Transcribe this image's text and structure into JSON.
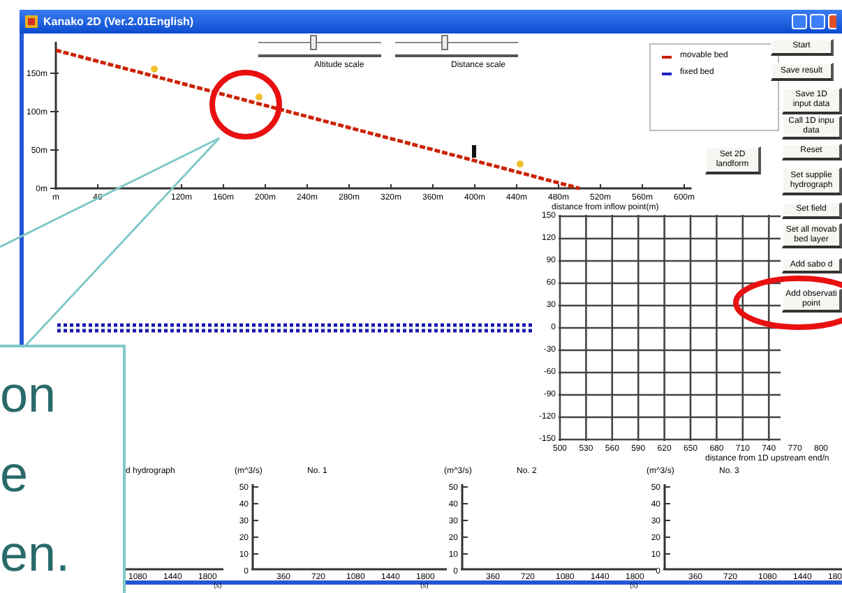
{
  "window": {
    "title": "Kanako 2D (Ver.2.01English)"
  },
  "sliders": [
    {
      "label": "Altitude scale",
      "level": 0.45
    },
    {
      "label": "Distance scale",
      "level": 0.4
    }
  ],
  "legend": [
    {
      "label": "fixed bed",
      "color": "#2020c0"
    }
  ],
  "profile": {
    "chart_data": {
      "type": "line",
      "x": [
        0,
        50,
        100,
        150,
        200,
        250,
        300,
        350,
        400,
        450,
        500
      ],
      "xlim": [
        0,
        607
      ],
      "ylim": [
        0,
        191
      ],
      "series": [
        {
          "name": "movable bed",
          "color": "#cc2200",
          "line_style": "dashed",
          "values": [
            180,
            162,
            144,
            126,
            108,
            90,
            72,
            54,
            36,
            18,
            0
          ]
        }
      ],
      "xticks": [
        {
          "value": 0,
          "label": "m"
        },
        {
          "value": 40,
          "label": "40"
        },
        {
          "value": 120,
          "label": "120m"
        },
        {
          "value": 160,
          "label": "160m"
        },
        {
          "value": 200,
          "label": "200m"
        },
        {
          "value": 240,
          "label": "240m"
        },
        {
          "value": 280,
          "label": "280m"
        },
        {
          "value": 320,
          "label": "320m"
        },
        {
          "value": 360,
          "label": "360m"
        },
        {
          "value": 400,
          "label": "400m"
        },
        {
          "value": 440,
          "label": "440m"
        },
        {
          "value": 480,
          "label": "480m"
        },
        {
          "value": 520,
          "label": "520m"
        },
        {
          "value": 560,
          "label": "560m"
        },
        {
          "value": 600,
          "label": "600m"
        }
      ],
      "yticks": [
        {
          "value": 0,
          "label": "0m"
        },
        {
          "value": 50,
          "label": "50m"
        },
        {
          "value": 100,
          "label": "100m"
        },
        {
          "value": 150,
          "label": "150m"
        }
      ]
    }
  },
  "buttons": [
    {
      "label": "Start"
    },
    {
      "label": "Save result"
    },
    {
      "label": "Save 1D\ninput data"
    },
    {
      "label": "Call 1D inpu\ndata"
    },
    {
      "label": "Reset"
    },
    {
      "label": "Set supplie\nhydrograph"
    },
    {
      "label": "Set field"
    },
    {
      "label": "Set all movab\nbed layer"
    },
    {
      "label": "Add sabo d"
    },
    {
      "label": "Add observati\npoint"
    }
  ],
  "landform_button": {
    "label": "Set 2D\nlandform"
  },
  "plan_view": {
    "title": "distance from inflow point(m)",
    "yticks": [
      "150",
      "120",
      "90",
      "60",
      "30",
      "0",
      "-30",
      "-60",
      "-90",
      "-120",
      "-150"
    ],
    "xticks": [
      "500",
      "530",
      "560",
      "590",
      "620",
      "650",
      "680",
      "710",
      "740",
      "770",
      "800"
    ],
    "xlabel": "distance from 1D upstream end/n"
  },
  "hydrographs": [
    {
      "title": "d hydrograph",
      "xticks": [
        "1080",
        "1440",
        "1800"
      ],
      "xunit": "(s)"
    },
    {
      "unit": "(m^3/s)",
      "title": "No. 1",
      "yticks": [
        "50",
        "40",
        "30",
        "20",
        "10",
        "0"
      ],
      "xticks": [
        "360",
        "720",
        "1080",
        "1440",
        "1800"
      ],
      "xunit": "(s)"
    },
    {
      "unit": "(m^3/s)",
      "title": "No. 2",
      "yticks": [
        "50",
        "40",
        "30",
        "20",
        "10",
        "0"
      ],
      "xticks": [
        "360",
        "720",
        "1080",
        "1440",
        "1800"
      ],
      "xunit": "(s)"
    },
    {
      "unit": "(m^3/s)",
      "title": "No. 3",
      "yticks": [
        "50",
        "40",
        "30",
        "20",
        "10",
        "0"
      ],
      "xticks": [
        "360",
        "720",
        "1080",
        "1440",
        "180"
      ]
    }
  ],
  "callout": {
    "lines": [
      "on",
      "e",
      "en."
    ]
  }
}
